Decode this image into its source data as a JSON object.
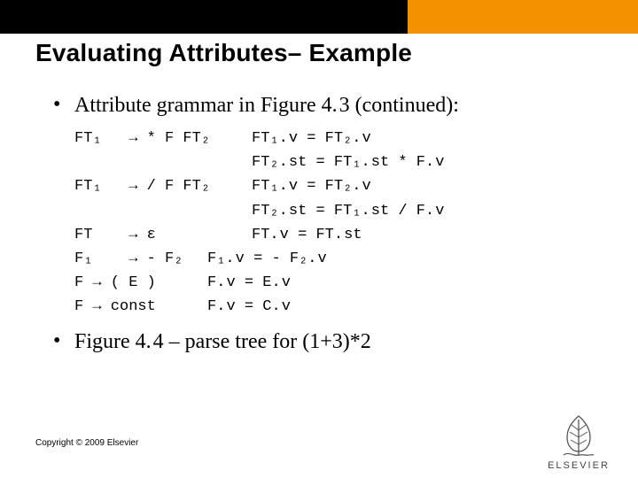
{
  "title": "Evaluating Attributes– Example",
  "bullets": {
    "b1": "Attribute grammar in Figure 4. 3 (continued):",
    "b2": "Figure 4. 4 – parse tree for (1+3)*2"
  },
  "grammar": {
    "rows": [
      {
        "lhs": "FT₁   → * F FT₂",
        "rhs": "FT₁. v = FT₂. v"
      },
      {
        "lhs": "",
        "rhs": "FT₂. st = FT₁. st * F. v"
      },
      {
        "lhs": "FT₁   → / F FT₂",
        "rhs": "FT₁. v = FT₂. v"
      },
      {
        "lhs": "",
        "rhs": "FT₂. st = FT₁. st / F. v"
      },
      {
        "lhs": "FT    → ε",
        "rhs": "FT. v = FT. st"
      },
      {
        "lhs": "F₁    → - F₂",
        "rhs2": "F₁. v = - F₂. v"
      },
      {
        "lhs": "F → ( E )",
        "rhs2": "F. v = E. v"
      },
      {
        "lhs": "F → const",
        "rhs2": "F. v = C. v"
      }
    ]
  },
  "copyright": "Copyright © 2009 Elsevier",
  "logo_text": "ELSEVIER"
}
